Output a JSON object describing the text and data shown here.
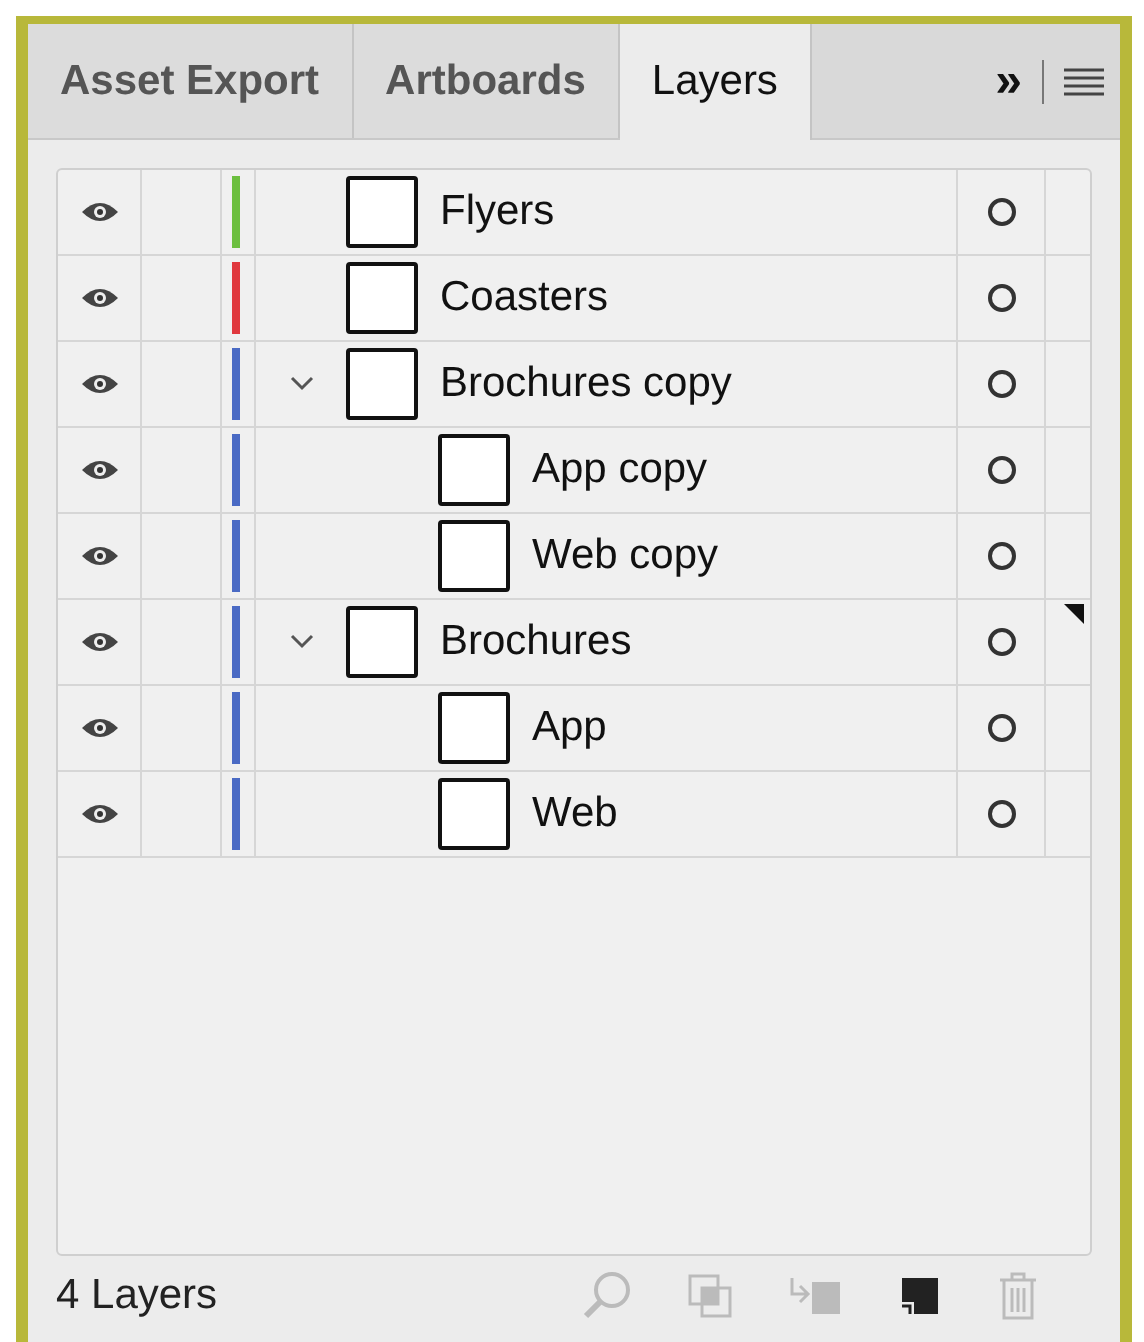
{
  "tabs": [
    {
      "label": "Asset Export",
      "selected": false
    },
    {
      "label": "Artboards",
      "selected": false
    },
    {
      "label": "Layers",
      "selected": true
    }
  ],
  "overflow": "»",
  "layers": [
    {
      "name": "Flyers",
      "color": "#6cbf3f",
      "visible": true,
      "current": false
    },
    {
      "name": "Coasters",
      "color": "#e0383e",
      "visible": true,
      "current": false
    },
    {
      "name": "Brochures copy",
      "color": "#4a6ac4",
      "visible": true,
      "current": false,
      "expanded": true,
      "children": [
        {
          "name": "App copy",
          "visible": true
        },
        {
          "name": "Web copy",
          "visible": true
        }
      ]
    },
    {
      "name": "Brochures",
      "color": "#4a6ac4",
      "visible": true,
      "current": true,
      "expanded": true,
      "children": [
        {
          "name": "App",
          "visible": true
        },
        {
          "name": "Web",
          "visible": true
        }
      ]
    }
  ],
  "status": "4 Layers",
  "footer_buttons": [
    {
      "kind": "search",
      "disabled": true
    },
    {
      "kind": "clip",
      "disabled": true
    },
    {
      "kind": "move",
      "disabled": true
    },
    {
      "kind": "new",
      "disabled": false
    },
    {
      "kind": "delete",
      "disabled": true
    }
  ]
}
